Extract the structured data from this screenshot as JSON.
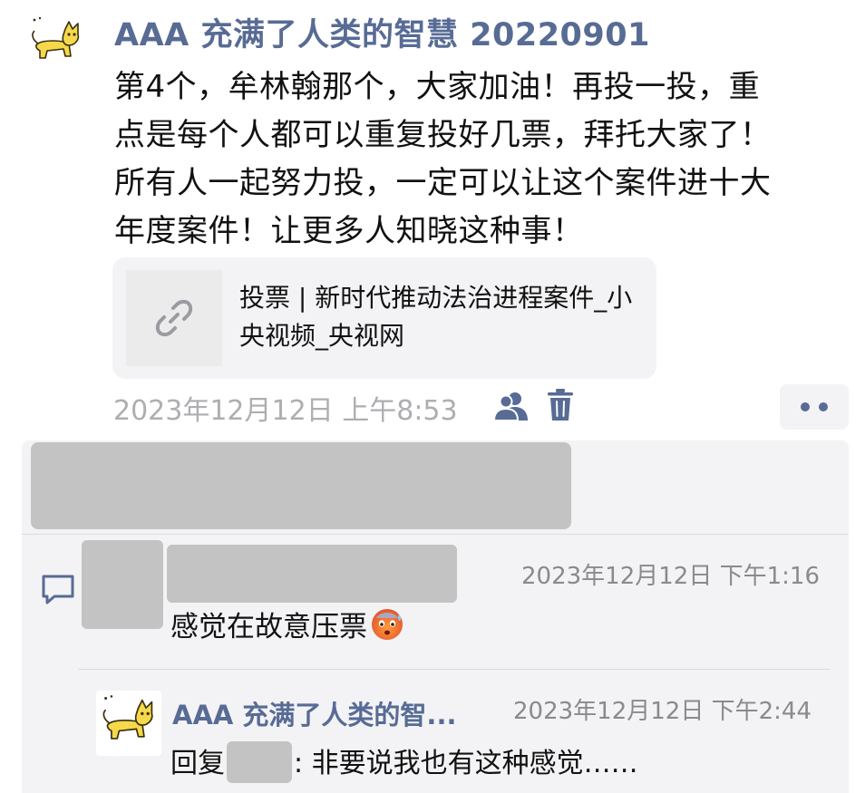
{
  "post": {
    "author": "AAA 充满了人类的智慧 20220901",
    "avatar_icon": "cat-icon",
    "body": "第4个，牟林翰那个，大家加油！再投一投，重\n点是每个人都可以重复投好几票，拜托大家了！\n所有人一起努力投，一定可以让这个案件进十大\n年度案件！让更多人知晓这种事！",
    "link": {
      "icon": "link-icon",
      "title": "投票 | 新时代推动法治进程案件_小央视频_央视网"
    },
    "time": "2023年12月12日 上午8:53",
    "visibility_icon": "contacts-icon",
    "delete_icon": "trash-icon",
    "more_icon": "more-dots-icon"
  },
  "likes": {
    "redacted": true
  },
  "comments": [
    {
      "author_redacted": true,
      "time": "2023年12月12日 下午1:16",
      "text": "感觉在故意压票",
      "emoji": "cold-sweat-face-emoji"
    },
    {
      "author": "AAA 充满了人类的智...",
      "time": "2023年12月12日 下午2:44",
      "reply_prefix": "回复",
      "reply_target_redacted": true,
      "text": ": 非要说我也有这种感觉……"
    }
  ],
  "colors": {
    "name_blue": "#576b95",
    "time_gray": "#aeaeb2",
    "comment_bg": "#f3f3f5",
    "redaction_gray": "#c3c3c3"
  }
}
